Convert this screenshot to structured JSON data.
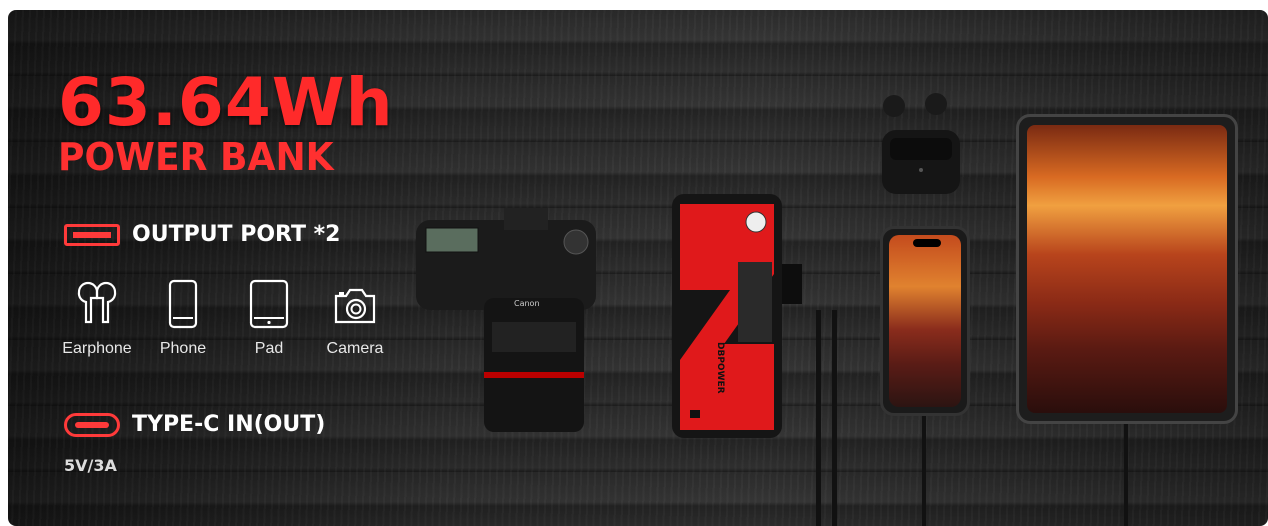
{
  "headline": {
    "capacity": "63.64Wh",
    "product": "POWER BANK"
  },
  "output": {
    "label": "OUTPUT PORT *2",
    "icon": "usb-a-port-icon"
  },
  "devices": [
    {
      "name": "Earphone",
      "icon": "earphone-icon"
    },
    {
      "name": "Phone",
      "icon": "phone-icon"
    },
    {
      "name": "Pad",
      "icon": "tablet-icon"
    },
    {
      "name": "Camera",
      "icon": "camera-icon"
    }
  ],
  "input": {
    "label": "TYPE-C IN(OUT)",
    "spec": "5V/3A",
    "icon": "usb-c-port-icon"
  },
  "brand": {
    "device_brand": "DBPOWER",
    "camera_brand": "Canon"
  },
  "colors": {
    "accent": "#ff2a2a",
    "background": "#2b2b2b",
    "text": "#ffffff"
  }
}
